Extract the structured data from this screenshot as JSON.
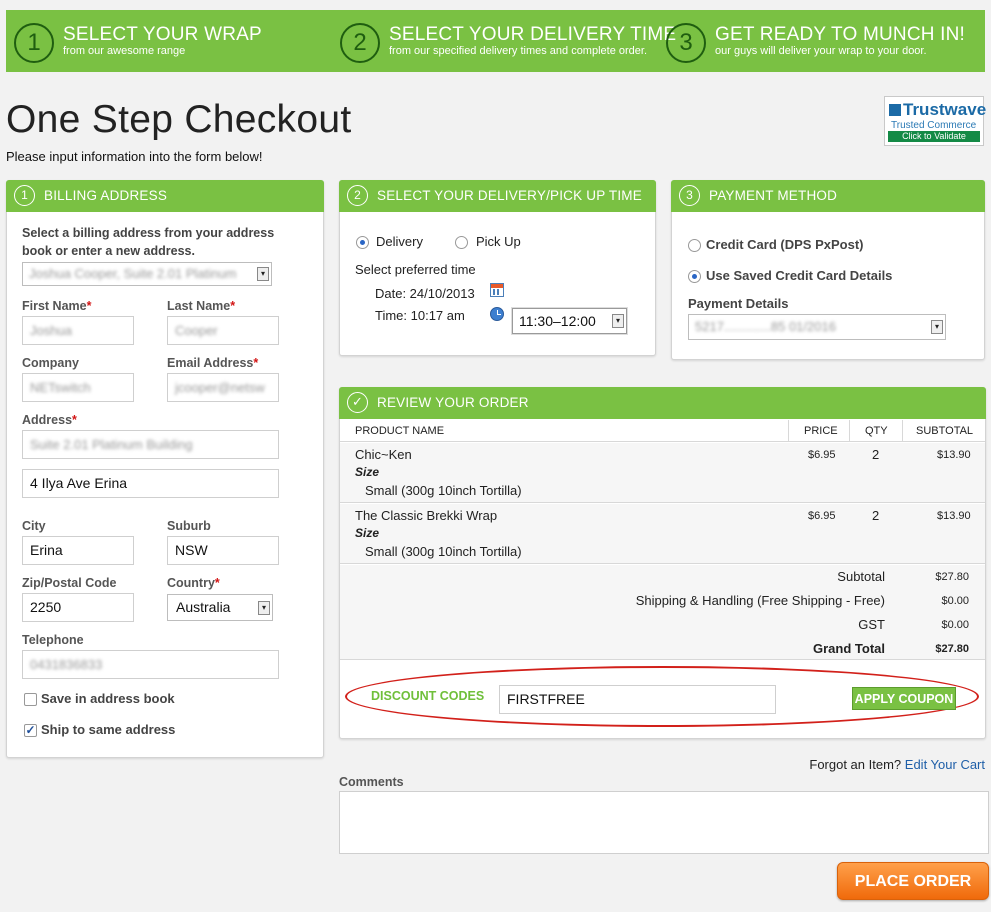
{
  "steps": [
    {
      "num": "1",
      "title": "SELECT YOUR WRAP",
      "sub": "from our awesome range"
    },
    {
      "num": "2",
      "title": "SELECT YOUR DELIVERY TIME",
      "sub": "from our specified delivery times and complete order."
    },
    {
      "num": "3",
      "title": "GET READY TO MUNCH IN!",
      "sub": "our guys will deliver your wrap to your door."
    }
  ],
  "page": {
    "title": "One Step Checkout",
    "subtitle": "Please input information into the form below!"
  },
  "trust_badge": {
    "name": "Trustwave",
    "tagline": "Trusted Commerce",
    "action": "Click to Validate"
  },
  "billing": {
    "num": "1",
    "title": "BILLING ADDRESS",
    "intro": "Select a billing address from your address book or enter a new address.",
    "address_select": "Joshua Cooper, Suite 2.01 Platinum",
    "required_mark": "*",
    "first_name_label": "First Name",
    "first_name": "Joshua",
    "last_name_label": "Last Name",
    "last_name": "Cooper",
    "company_label": "Company",
    "company": "NETswitch",
    "email_label": "Email Address",
    "email": "jcooper@netsw",
    "address_label": "Address",
    "address1": "Suite 2.01 Platinum Building",
    "address2": "4 Ilya Ave Erina",
    "city_label": "City",
    "city": "Erina",
    "suburb_label": "Suburb",
    "suburb": "NSW",
    "zip_label": "Zip/Postal Code",
    "zip": "2250",
    "country_label": "Country",
    "country": "Australia",
    "telephone_label": "Telephone",
    "telephone": "0431836833",
    "save_label": "Save in address book",
    "save_checked": false,
    "ship_label": "Ship to same address",
    "ship_checked": true
  },
  "delivery": {
    "num": "2",
    "title": "SELECT YOUR DELIVERY/PICK UP TIME",
    "option_delivery": "Delivery",
    "option_pickup": "Pick Up",
    "selected": "Delivery",
    "preferred": "Select preferred time",
    "date_label": "Date: 24/10/2013",
    "time_label": "Time: 10:17 am",
    "time_select": "11:30–12:00"
  },
  "payment": {
    "num": "3",
    "title": "PAYMENT METHOD",
    "option_card": "Credit Card (DPS PxPost)",
    "option_saved": "Use Saved Credit Card Details",
    "selected": "Use Saved Credit Card Details",
    "details_label": "Payment Details",
    "details_select": "5217.............85 01/2016"
  },
  "review": {
    "title": "REVIEW YOUR ORDER",
    "headers": [
      "PRODUCT NAME",
      "PRICE",
      "QTY",
      "SUBTOTAL"
    ],
    "items": [
      {
        "name": "Chic~Ken",
        "option_label": "Size",
        "option_value": "Small (300g 10inch Tortilla)",
        "price": "$6.95",
        "qty": "2",
        "subtotal": "$13.90"
      },
      {
        "name": "The Classic Brekki Wrap",
        "option_label": "Size",
        "option_value": "Small (300g 10inch Tortilla)",
        "price": "$6.95",
        "qty": "2",
        "subtotal": "$13.90"
      }
    ],
    "totals": [
      {
        "label": "Subtotal",
        "value": "$27.80"
      },
      {
        "label": "Shipping & Handling (Free Shipping - Free)",
        "value": "$0.00"
      },
      {
        "label": "GST",
        "value": "$0.00"
      },
      {
        "label": "Grand Total",
        "value": "$27.80"
      }
    ],
    "discount_label": "DISCOUNT CODES",
    "discount_value": "FIRSTFREE",
    "apply_label": "APPLY COUPON"
  },
  "forgot": {
    "text": "Forgot an Item?",
    "link": "Edit Your Cart"
  },
  "comments": {
    "label": "Comments",
    "value": ""
  },
  "place_order": "PLACE ORDER",
  "colors": {
    "brand_green": "#7ac143",
    "order_orange": "#f47f1f",
    "highlight_red": "#d2201a",
    "link_blue": "#1f5fa8"
  }
}
